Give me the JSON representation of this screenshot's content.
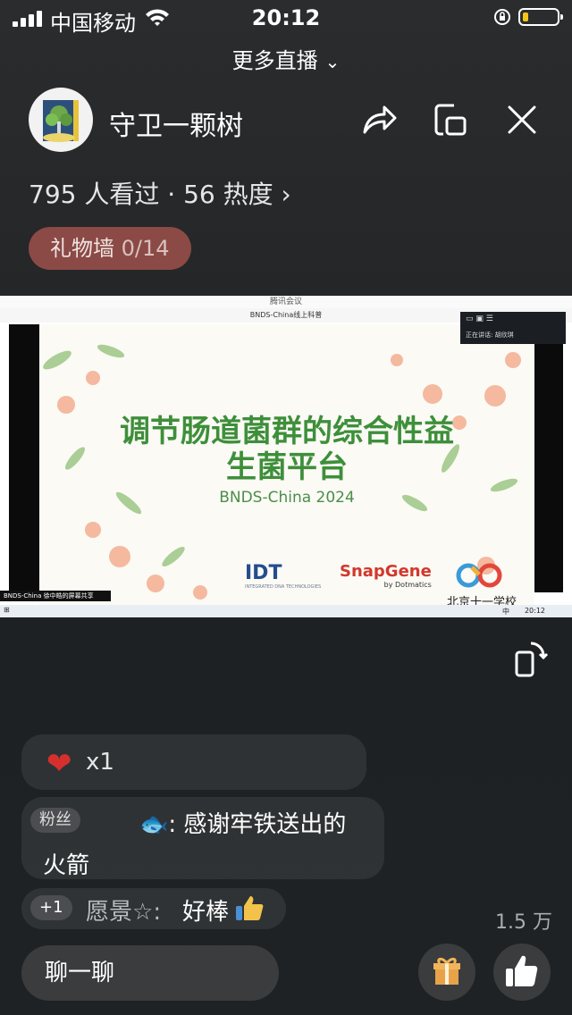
{
  "status": {
    "carrier": "中国移动",
    "time": "20:12"
  },
  "header": {
    "more_live": "更多直播",
    "channel_name": "守卫一颗树"
  },
  "stats": {
    "viewed": "795 人看过",
    "separator": " · ",
    "heat": "56 热度"
  },
  "gift_wall": {
    "label": "礼物墙",
    "count": "0/14"
  },
  "video": {
    "window_title": "腾讯会议",
    "meeting_title": "BNDS-China线上科普",
    "slide_title_line1": "调节肠道菌群的综合性益",
    "slide_title_line2": "生菌平台",
    "slide_subtitle": "BNDS-China 2024",
    "sponsor_idt": "IDT",
    "sponsor_idt_sub": "INTEGRATED DNA TECHNOLOGIES",
    "sponsor_snapgene": "SnapGene",
    "sponsor_snapgene_sub": "by Dotmatics",
    "school": "北京十一学校",
    "speaking_label": "正在讲话:",
    "speaking_name": "胡欣琪",
    "share_caption": "BNDS-China 徐中皓的屏幕共享",
    "taskbar_lang": "中",
    "taskbar_time": "20:12"
  },
  "comments": {
    "gift": {
      "count": "x1",
      "icon": "heart"
    },
    "thanks": {
      "badge": "粉丝",
      "user": "🐟",
      "text": "感谢牢铁送出的火箭"
    },
    "praise": {
      "badge": "+1",
      "user": "愿景☆",
      "text": "好棒"
    }
  },
  "footer": {
    "likes": "1.5 万",
    "chat_label": "聊一聊"
  },
  "colors": {
    "accent_gift_wall": "#8b4a45",
    "slide_title": "#3e8f3a"
  }
}
